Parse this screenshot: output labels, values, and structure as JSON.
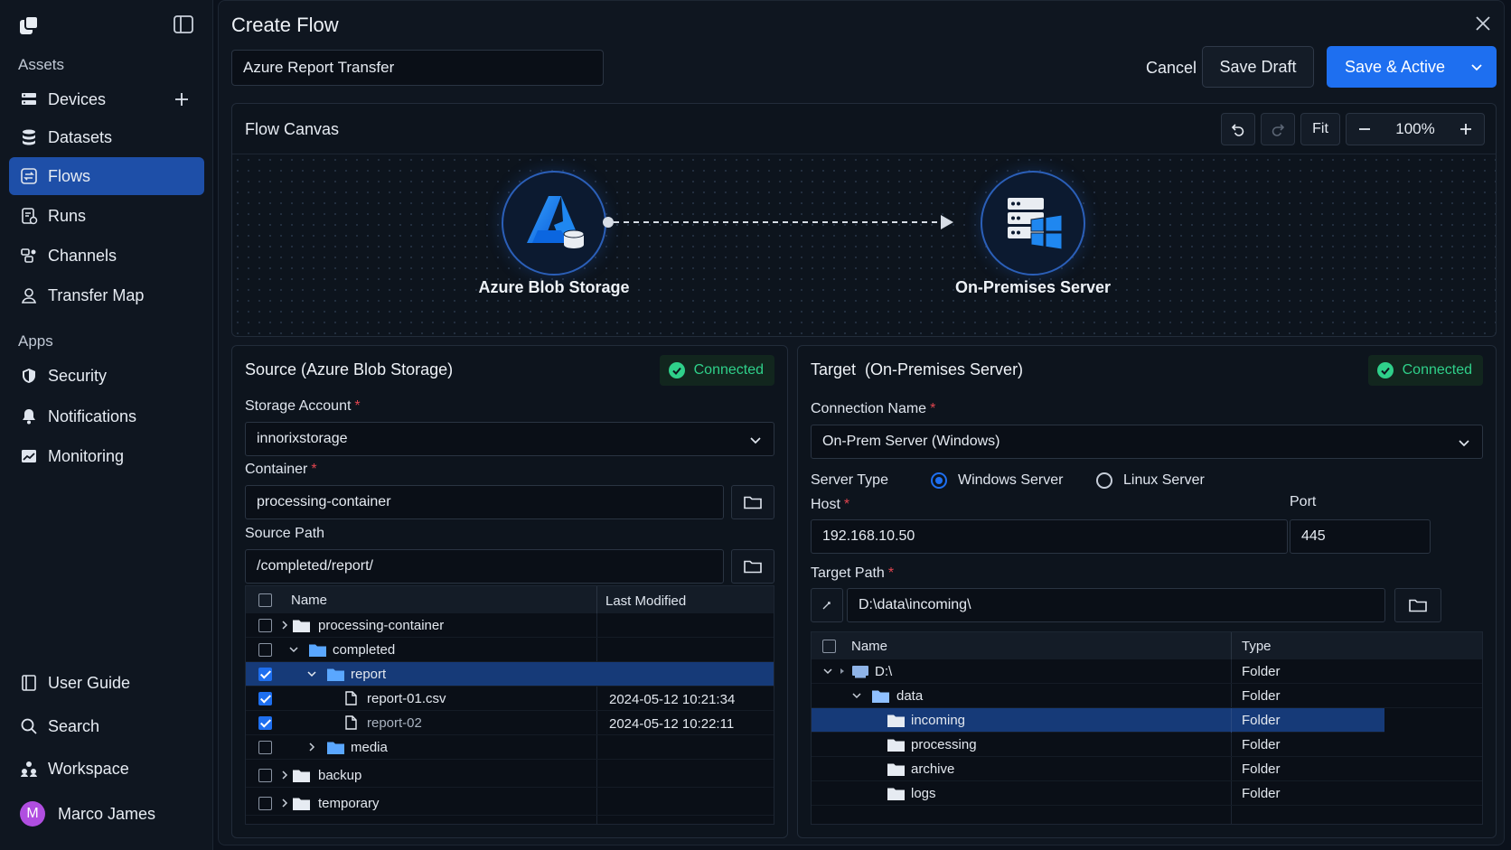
{
  "sidebar": {
    "assets_label": "Assets",
    "apps_label": "Apps",
    "items": [
      {
        "label": "Devices"
      },
      {
        "label": "Datasets"
      },
      {
        "label": "Flows"
      },
      {
        "label": "Runs"
      },
      {
        "label": "Channels"
      },
      {
        "label": "Transfer Map"
      },
      {
        "label": "Security"
      },
      {
        "label": "Notifications"
      },
      {
        "label": "Monitoring"
      }
    ],
    "footer": [
      {
        "label": "User Guide"
      },
      {
        "label": "Search"
      },
      {
        "label": "Workspace"
      }
    ],
    "user": {
      "initial": "M",
      "name": "Marco James"
    }
  },
  "header": {
    "title": "Create Flow",
    "flow_name": "Azure Report Transfer",
    "cancel": "Cancel",
    "save_draft": "Save Draft",
    "save_active": "Save & Active"
  },
  "canvas": {
    "title": "Flow Canvas",
    "fit": "Fit",
    "zoom": "100%",
    "source_node": "Azure Blob Storage",
    "target_node": "On-Premises Server"
  },
  "source": {
    "title": "Source (Azure Blob Storage)",
    "status": "Connected",
    "storage_account_label": "Storage Account",
    "storage_account": "innorixstorage",
    "container_label": "Container",
    "container": "processing-container",
    "path_label": "Source Path",
    "path": "/completed/report/",
    "col_name": "Name",
    "col_modified": "Last Modified",
    "rows": [
      {
        "name": "processing-container",
        "modified": ""
      },
      {
        "name": "completed",
        "modified": ""
      },
      {
        "name": "report",
        "modified": ""
      },
      {
        "name": "report-01.csv",
        "modified": "2024-05-12 10:21:34"
      },
      {
        "name": "report-02",
        "modified": "2024-05-12 10:22:11"
      },
      {
        "name": "media",
        "modified": ""
      },
      {
        "name": "backup",
        "modified": ""
      },
      {
        "name": "temporary",
        "modified": ""
      }
    ]
  },
  "target": {
    "title": "Target  (On-Premises Server)",
    "status": "Connected",
    "connection_label": "Connection Name",
    "connection": "On-Prem Server (Windows)",
    "server_type_label": "Server Type",
    "windows": "Windows Server",
    "linux": "Linux Server",
    "host_label": "Host",
    "host": "192.168.10.50",
    "port_label": "Port",
    "port": "445",
    "path_label": "Target Path",
    "path": "D:\\data\\incoming\\",
    "col_name": "Name",
    "col_type": "Type",
    "rows": [
      {
        "name": "D:\\",
        "type": "Folder"
      },
      {
        "name": "data",
        "type": "Folder"
      },
      {
        "name": "incoming",
        "type": "Folder"
      },
      {
        "name": "processing",
        "type": "Folder"
      },
      {
        "name": "archive",
        "type": "Folder"
      },
      {
        "name": "logs",
        "type": "Folder"
      }
    ]
  },
  "colors": {
    "accent": "#1e6ff0",
    "selection": "#163a78",
    "connected": "#2fd08a",
    "required": "#e0454f"
  }
}
